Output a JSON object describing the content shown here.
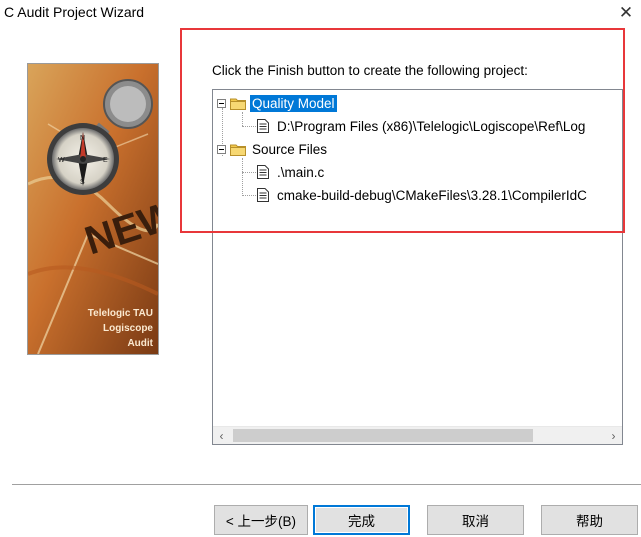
{
  "window": {
    "title": "C Audit Project Wizard",
    "close_symbol": "✕"
  },
  "side_image": {
    "caption_lines": [
      "Telelogic TAU",
      "Logiscope",
      "Audit"
    ],
    "map_text": "NEW",
    "compass_letters": [
      "N",
      "E",
      "S",
      "W"
    ]
  },
  "intro_text": "Click the Finish button to create the following project:",
  "tree": {
    "groups": [
      {
        "label": "Quality Model",
        "selected": true,
        "children": [
          "D:\\Program Files (x86)\\Telelogic\\Logiscope\\Ref\\Log"
        ]
      },
      {
        "label": "Source Files",
        "selected": false,
        "children": [
          ".\\main.c",
          "cmake-build-debug\\CMakeFiles\\3.28.1\\CompilerIdC"
        ]
      }
    ]
  },
  "buttons": {
    "back": "< 上一步(B)",
    "finish": "完成",
    "cancel": "取消",
    "help": "帮助"
  },
  "colors": {
    "selection": "#0078d7",
    "highlight_border": "#e8373a",
    "folder": "#f2c84b"
  }
}
